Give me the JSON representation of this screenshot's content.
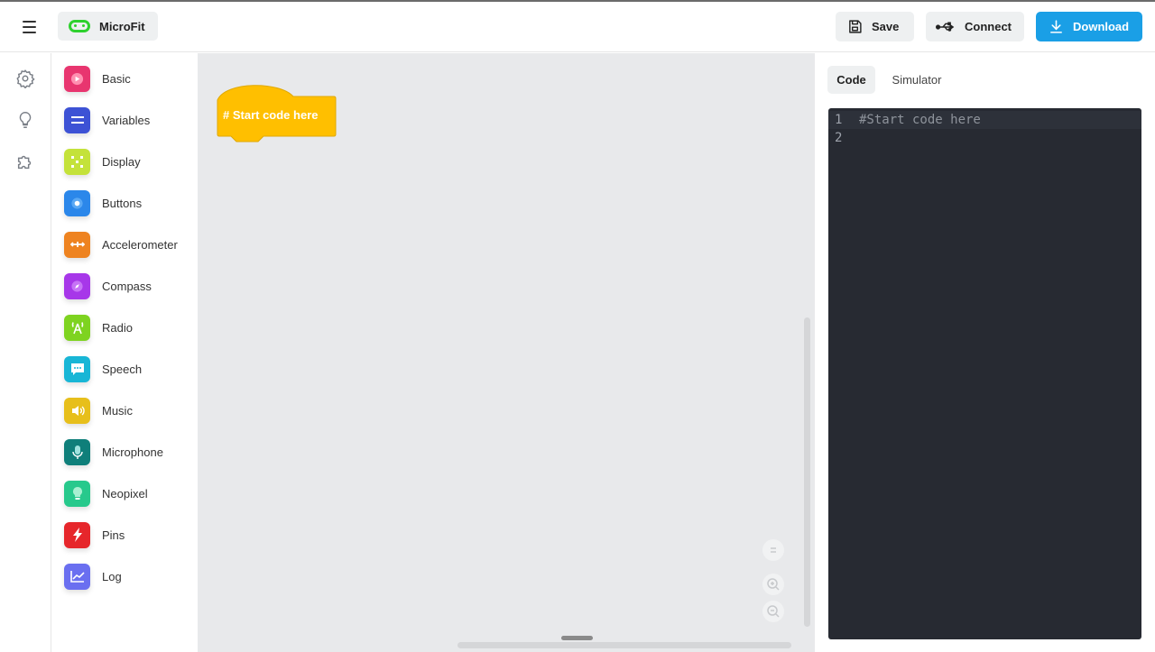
{
  "header": {
    "app_name": "MicroFit",
    "save_label": "Save",
    "connect_label": "Connect",
    "download_label": "Download",
    "download_color": "#1a9fe6",
    "brand_color": "#2ed12e"
  },
  "rail": {
    "icons": [
      "settings-icon",
      "lightbulb-icon",
      "puzzle-icon"
    ]
  },
  "palette": {
    "categories": [
      {
        "label": "Basic",
        "color": "#e8356f",
        "icon": "play-icon"
      },
      {
        "label": "Variables",
        "color": "#3d52d5",
        "icon": "equals-icon"
      },
      {
        "label": "Display",
        "color": "#c4e23a",
        "icon": "grid-icon"
      },
      {
        "label": "Buttons",
        "color": "#2b87ea",
        "icon": "button-icon"
      },
      {
        "label": "Accelerometer",
        "color": "#ee8320",
        "icon": "move-icon"
      },
      {
        "label": "Compass",
        "color": "#a737e9",
        "icon": "compass-icon"
      },
      {
        "label": "Radio",
        "color": "#7ed320",
        "icon": "radio-icon"
      },
      {
        "label": "Speech",
        "color": "#18b6d6",
        "icon": "speech-icon"
      },
      {
        "label": "Music",
        "color": "#e7bf1b",
        "icon": "speaker-icon"
      },
      {
        "label": "Microphone",
        "color": "#0f7f7a",
        "icon": "microphone-icon"
      },
      {
        "label": "Neopixel",
        "color": "#27c98c",
        "icon": "bulb-icon"
      },
      {
        "label": "Pins",
        "color": "#e6262b",
        "icon": "lightning-icon"
      },
      {
        "label": "Log",
        "color": "#6a6ff0",
        "icon": "chart-icon"
      }
    ]
  },
  "workspace": {
    "block_text": "# Start code here",
    "block_color": "#ffbf00"
  },
  "right_panel": {
    "tabs": [
      {
        "label": "Code",
        "active": true
      },
      {
        "label": "Simulator",
        "active": false
      }
    ],
    "editor_lines": [
      {
        "num": "1",
        "text": "#Start code here"
      },
      {
        "num": "2",
        "text": ""
      }
    ]
  }
}
